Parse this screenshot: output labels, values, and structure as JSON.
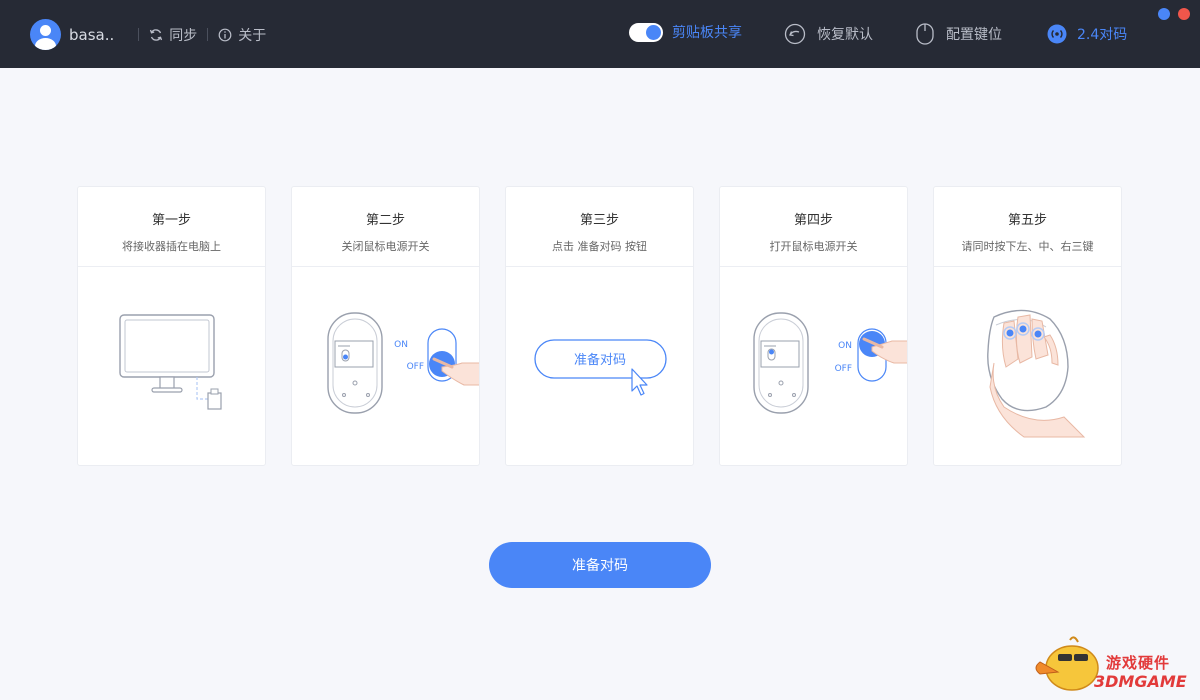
{
  "topbar": {
    "username": "basa..",
    "sync_label": "同步",
    "about_label": "关于",
    "clipboard_label": "剪贴板共享",
    "clipboard_enabled": true,
    "restore_label": "恢复默认",
    "keys_label": "配置键位",
    "pair24_label": "2.4对码"
  },
  "colors": {
    "accent": "#4a86f7",
    "topbar_bg": "#262a35",
    "page_bg": "#f6f7fb",
    "window_blue": "#4a86f7",
    "window_red": "#f0564b"
  },
  "steps": [
    {
      "title": "第一步",
      "desc": "将接收器插在电脑上"
    },
    {
      "title": "第二步",
      "desc": "关闭鼠标电源开关",
      "on": "ON",
      "off": "OFF"
    },
    {
      "title": "第三步",
      "desc": "点击 准备对码 按钮",
      "button": "准备对码"
    },
    {
      "title": "第四步",
      "desc": "打开鼠标电源开关",
      "on": "ON",
      "off": "OFF"
    },
    {
      "title": "第五步",
      "desc": "请同时按下左、中、右三键"
    }
  ],
  "pair_button": "准备对码",
  "watermark": {
    "line1": "游戏硬件",
    "line2": "3DMGAME"
  }
}
